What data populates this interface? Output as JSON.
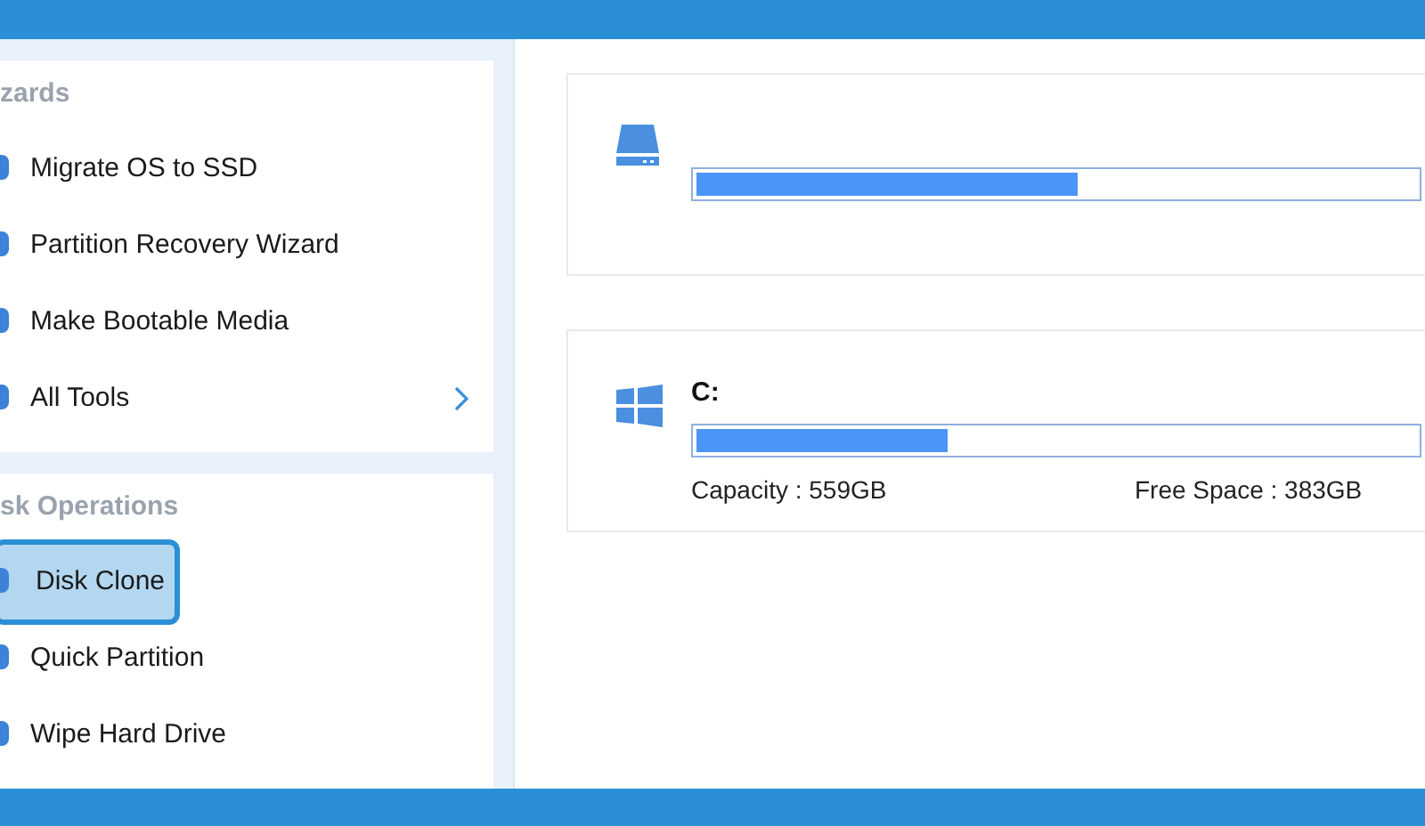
{
  "sidebar": {
    "sections": [
      {
        "heading": "zards",
        "items": [
          {
            "label": "Migrate OS to SSD",
            "selected": false,
            "arrow": false
          },
          {
            "label": "Partition Recovery Wizard",
            "selected": false,
            "arrow": false
          },
          {
            "label": "Make Bootable Media",
            "selected": false,
            "arrow": false
          },
          {
            "label": "All Tools",
            "selected": false,
            "arrow": true
          }
        ]
      },
      {
        "heading": "sk Operations",
        "items": [
          {
            "label": "Disk Clone",
            "selected": true,
            "arrow": false
          },
          {
            "label": "Quick Partition",
            "selected": false,
            "arrow": false
          },
          {
            "label": "Wipe Hard Drive",
            "selected": false,
            "arrow": false
          }
        ]
      }
    ]
  },
  "disks": [
    {
      "kind": "disk",
      "level": 0.53
    },
    {
      "kind": "partition",
      "name": "C:",
      "level": 0.35,
      "capacity": "Capacity : 559GB",
      "free_space": "Free Space : 383GB"
    }
  ]
}
